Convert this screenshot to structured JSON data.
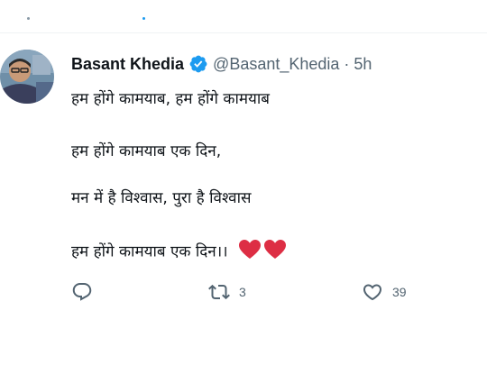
{
  "tweet": {
    "author": {
      "name": "Basant Khedia",
      "handle": "@Basant_Khedia",
      "verified": true
    },
    "separator": "·",
    "time": "5h",
    "lines": [
      "हम होंगे कामयाब, हम होंगे कामयाब",
      "हम होंगे कामयाब एक दिन,",
      "मन में है विश्वास, पुरा है विश्वास",
      "हम होंगे कामयाब एक दिन।।"
    ],
    "emoji": "heart-emoji x2",
    "actions": {
      "reply_count": "",
      "retweet_count": "3",
      "like_count": "39"
    }
  },
  "colors": {
    "text": "#0f1419",
    "secondary": "#536471",
    "verified": "#1d9bf0",
    "heart": "#dd2e44"
  },
  "icons": [
    "reply-icon",
    "retweet-icon",
    "like-icon",
    "verified-badge-icon"
  ]
}
